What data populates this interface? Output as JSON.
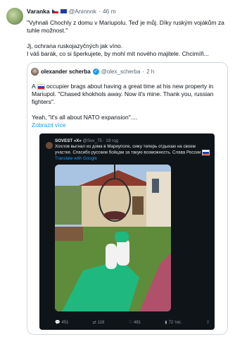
{
  "tweet": {
    "author_name": "Varanka",
    "handle": "@Aninnnk",
    "separator": "·",
    "time": "46 m",
    "lines": [
      "\"Vyhnali Chochly z domu v Mariupolu. Teď je můj. Díky ruským vojákům za",
      "tuhle možnost.\"",
      "Jj, ochrana ruskojazyčných jak víno.",
      "I váš barák, co si šperkujete, by mohl mít nového majitele. Chcimíři..."
    ]
  },
  "quote": {
    "author_name": "olexander scherba",
    "handle": "@olex_scherba",
    "separator": "·",
    "time": "2 h",
    "lines": [
      "A occupier brags about having a great time at his new property in",
      "Mariupol. \"Chased khokhols away. Now it's mine. Thank you, russian",
      "fighters\".",
      "Yeah, \"it's all about NATO expansion\"...."
    ],
    "lead_word": "A",
    "rest_first_line": "occupier brags about having a great time at his new property in",
    "show_more": "Zobrazit více"
  },
  "embedded": {
    "author_name": "SOVEST «X»",
    "handle": "@Sov_75",
    "separator": "·",
    "time": "19 год",
    "text": "Хохлов выгнал из дома в Мариуполе, сижу теперь отдыхаю на своем участке. Спасибо русским бойцам за такую возможность. Слава России",
    "translate": "Translate with Google",
    "actions": {
      "reply": "451",
      "retweet": "118",
      "like": "481",
      "views": "72 тис."
    }
  },
  "colors": {
    "link": "#1d9bf0",
    "text": "#0f1419",
    "meta": "#536471",
    "media_bg": "#0f1419"
  },
  "icons": [
    "czech-flag-icon",
    "eu-flag-icon",
    "verified-icon",
    "russian-flag-icon",
    "reply-icon",
    "retweet-icon",
    "like-icon",
    "views-icon",
    "share-icon"
  ]
}
